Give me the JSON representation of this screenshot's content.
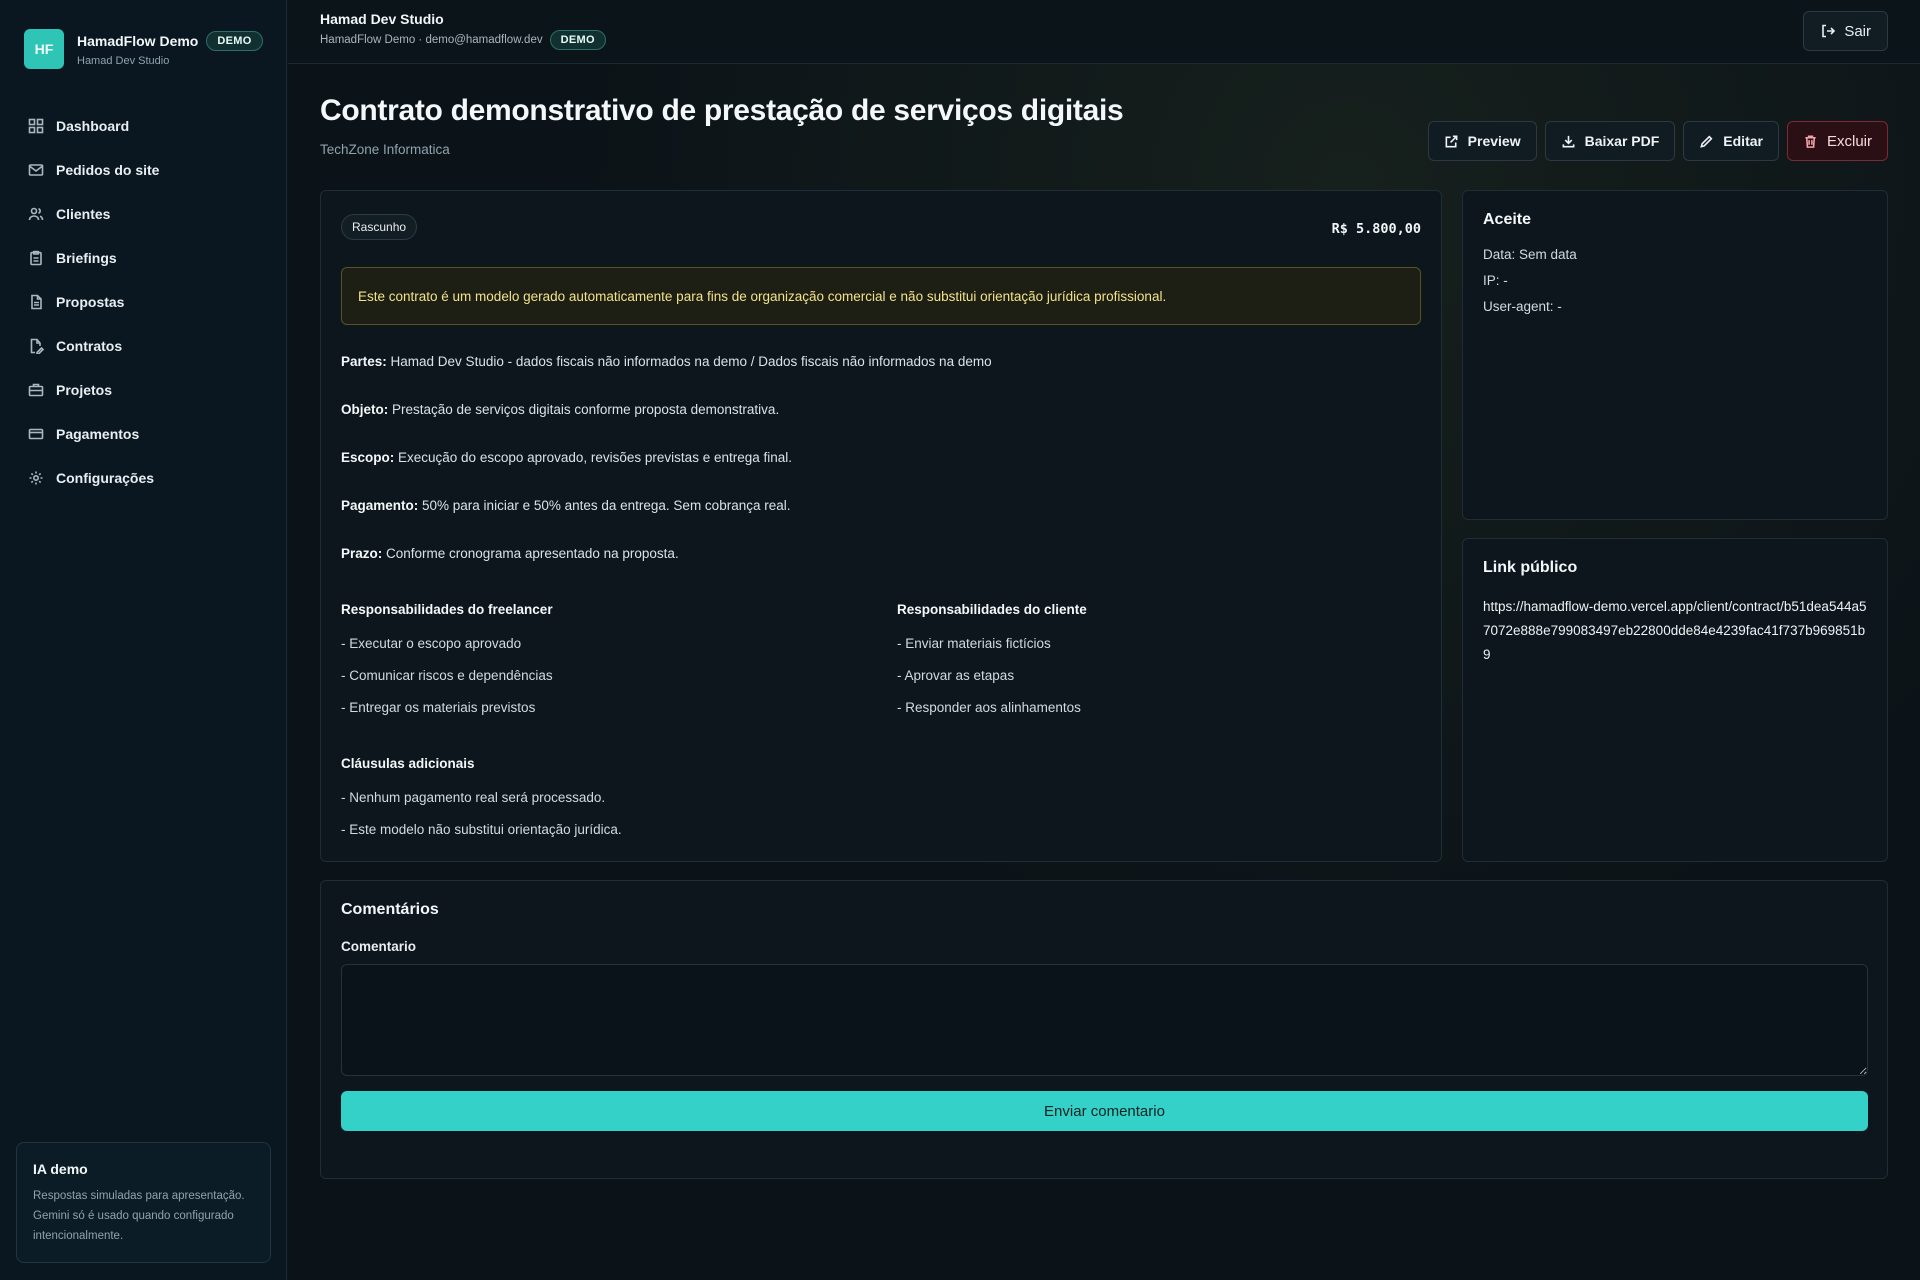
{
  "sidebar": {
    "logo": "HF",
    "brand_name": "HamadFlow Demo",
    "badge": "DEMO",
    "brand_sub": "Hamad Dev Studio",
    "items": [
      {
        "label": "Dashboard",
        "icon": "dashboard-icon"
      },
      {
        "label": "Pedidos do site",
        "icon": "mail-icon"
      },
      {
        "label": "Clientes",
        "icon": "users-icon"
      },
      {
        "label": "Briefings",
        "icon": "clipboard-icon"
      },
      {
        "label": "Propostas",
        "icon": "file-icon"
      },
      {
        "label": "Contratos",
        "icon": "file-signature-icon"
      },
      {
        "label": "Projetos",
        "icon": "briefcase-icon"
      },
      {
        "label": "Pagamentos",
        "icon": "credit-card-icon"
      },
      {
        "label": "Configurações",
        "icon": "gear-icon"
      }
    ],
    "ia": {
      "title": "IA demo",
      "text": "Respostas simuladas para apresentação. Gemini só é usado quando configurado intencionalmente."
    }
  },
  "topbar": {
    "title": "Hamad Dev Studio",
    "sub": "HamadFlow Demo · demo@hamadflow.dev",
    "badge": "DEMO",
    "logout_label": "Sair"
  },
  "page": {
    "title": "Contrato demonstrativo de prestação de serviços digitais",
    "client": "TechZone Informatica",
    "actions": {
      "preview": "Preview",
      "download": "Baixar PDF",
      "edit": "Editar",
      "delete": "Excluir"
    }
  },
  "contract": {
    "status": "Rascunho",
    "amount": "R$ 5.800,00",
    "notice": "Este contrato é um modelo gerado automaticamente para fins de organização comercial e não substitui orientação jurídica profissional.",
    "clauses": [
      {
        "label": "Partes:",
        "text": " Hamad Dev Studio - dados fiscais não informados na demo / Dados fiscais não informados na demo"
      },
      {
        "label": "Objeto:",
        "text": " Prestação de serviços digitais conforme proposta demonstrativa."
      },
      {
        "label": "Escopo:",
        "text": " Execução do escopo aprovado, revisões previstas e entrega final."
      },
      {
        "label": "Pagamento:",
        "text": " 50% para iniciar e 50% antes da entrega. Sem cobrança real."
      },
      {
        "label": "Prazo:",
        "text": " Conforme cronograma apresentado na proposta."
      }
    ],
    "freelancer": {
      "title": "Responsabilidades do freelancer",
      "items": [
        "- Executar o escopo aprovado",
        "- Comunicar riscos e dependências",
        "- Entregar os materiais previstos"
      ]
    },
    "client": {
      "title": "Responsabilidades do cliente",
      "items": [
        "- Enviar materiais fictícios",
        "- Aprovar as etapas",
        "- Responder aos alinhamentos"
      ]
    },
    "additional": {
      "title": "Cláusulas adicionais",
      "items": [
        "- Nenhum pagamento real será processado.",
        "- Este modelo não substitui orientação jurídica."
      ]
    }
  },
  "aceite": {
    "title": "Aceite",
    "date": "Data: Sem data",
    "ip": "IP: -",
    "user_agent": "User-agent: -"
  },
  "public_link": {
    "title": "Link público",
    "url": "https://hamadflow-demo.vercel.app/client/contract/b51dea544a57072e888e799083497eb22800dde84e4239fac41f737b969851b9"
  },
  "comments": {
    "title": "Comentários",
    "field_label": "Comentario",
    "placeholder": "",
    "submit_label": "Enviar comentario"
  }
}
